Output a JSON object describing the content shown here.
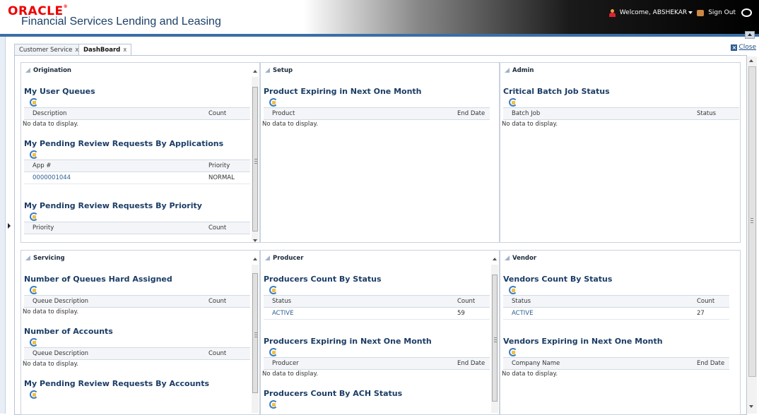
{
  "header": {
    "brand": "ORACLE",
    "brand_mark": "®",
    "product": "Financial Services Lending and Leasing",
    "welcome": "Welcome, ABSHEKAR",
    "signout": "Sign Out"
  },
  "tabs": [
    {
      "label": "Customer Service",
      "close": "x"
    },
    {
      "label": "DashBoard",
      "close": "x"
    }
  ],
  "close_label": "Close",
  "panels": {
    "origination": {
      "title": "Origination",
      "sections": [
        {
          "title": "My User Queues",
          "columns": [
            "Description",
            "Count"
          ],
          "empty": "No data to display."
        },
        {
          "title": "My Pending Review Requests By Applications",
          "columns": [
            "App #",
            "Priority"
          ],
          "rows": [
            [
              "0000001044",
              "NORMAL"
            ]
          ]
        },
        {
          "title": "My Pending Review Requests By Priority",
          "columns": [
            "Priority",
            "Count"
          ]
        }
      ]
    },
    "setup": {
      "title": "Setup",
      "sections": [
        {
          "title": "Product Expiring in Next One Month",
          "columns": [
            "Product",
            "End Date"
          ],
          "empty": "No data to display."
        }
      ]
    },
    "admin": {
      "title": "Admin",
      "sections": [
        {
          "title": "Critical Batch Job Status",
          "columns": [
            "Batch Job",
            "Status"
          ],
          "empty": "No data to display."
        }
      ]
    },
    "servicing": {
      "title": "Servicing",
      "sections": [
        {
          "title": "Number of Queues Hard Assigned",
          "columns": [
            "Queue Description",
            "Count"
          ],
          "empty": "No data to display."
        },
        {
          "title": "Number of Accounts",
          "columns": [
            "Queue Description",
            "Count"
          ],
          "empty": "No data to display."
        },
        {
          "title": "My Pending Review Requests By Accounts"
        }
      ]
    },
    "producer": {
      "title": "Producer",
      "sections": [
        {
          "title": "Producers Count By Status",
          "columns": [
            "Status",
            "Count"
          ],
          "rows": [
            [
              "ACTIVE",
              "59"
            ]
          ]
        },
        {
          "title": "Producers Expiring in Next One Month",
          "columns": [
            "Producer",
            "End Date"
          ],
          "empty": "No data to display."
        },
        {
          "title": "Producers Count By ACH Status"
        }
      ]
    },
    "vendor": {
      "title": "Vendor",
      "sections": [
        {
          "title": "Vendors Count By Status",
          "columns": [
            "Status",
            "Count"
          ],
          "rows": [
            [
              "ACTIVE",
              "27"
            ]
          ]
        },
        {
          "title": "Vendors Expiring in Next One Month",
          "columns": [
            "Company Name",
            "End Date"
          ],
          "empty": "No data to display."
        }
      ]
    }
  }
}
